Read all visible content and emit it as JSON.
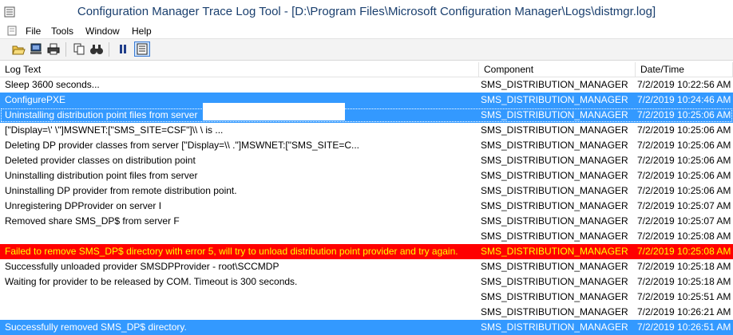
{
  "window": {
    "title": "Configuration Manager Trace Log Tool - [D:\\Program Files\\Microsoft Configuration Manager\\Logs\\distmgr.log]"
  },
  "menu": {
    "items": [
      "File",
      "Tools",
      "Window",
      "Help"
    ]
  },
  "toolbar": {
    "buttons": [
      "open-icon",
      "open-server-icon",
      "print-icon",
      "copy-icon",
      "find-icon",
      "pause-icon",
      "error-lookup-icon"
    ]
  },
  "columns": {
    "log_text": "Log Text",
    "component": "Component",
    "datetime": "Date/Time"
  },
  "rows": [
    {
      "text": "Sleep 3600 seconds...",
      "component": "SMS_DISTRIBUTION_MANAGER",
      "datetime": "7/2/2019 10:22:56 AM",
      "state": "normal"
    },
    {
      "text": "ConfigurePXE",
      "component": "SMS_DISTRIBUTION_MANAGER",
      "datetime": "7/2/2019 10:24:46 AM",
      "state": "selected"
    },
    {
      "text": "Uninstalling distribution point files from server",
      "component": "SMS_DISTRIBUTION_MANAGER",
      "datetime": "7/2/2019 10:25:06 AM",
      "state": "selected"
    },
    {
      "text": "[\"Display=\\'                                                                \\\"]MSWNET:[\"SMS_SITE=CSF\"]\\\\                                           \\ is ...",
      "component": "SMS_DISTRIBUTION_MANAGER",
      "datetime": "7/2/2019 10:25:06 AM",
      "state": "normal"
    },
    {
      "text": "Deleting DP provider classes from server [\"Display=\\\\                                                     .\"]MSWNET:[\"SMS_SITE=C...",
      "component": "SMS_DISTRIBUTION_MANAGER",
      "datetime": "7/2/2019 10:25:06 AM",
      "state": "normal"
    },
    {
      "text": "Deleted provider classes on distribution point",
      "component": "SMS_DISTRIBUTION_MANAGER",
      "datetime": "7/2/2019 10:25:06 AM",
      "state": "normal"
    },
    {
      "text": "Uninstalling distribution point files from server",
      "component": "SMS_DISTRIBUTION_MANAGER",
      "datetime": "7/2/2019 10:25:06 AM",
      "state": "normal"
    },
    {
      "text": "Uninstalling DP provider from remote distribution point.",
      "component": "SMS_DISTRIBUTION_MANAGER",
      "datetime": "7/2/2019 10:25:06 AM",
      "state": "normal"
    },
    {
      "text": "Unregistering DPProvider on server I",
      "component": "SMS_DISTRIBUTION_MANAGER",
      "datetime": "7/2/2019 10:25:07 AM",
      "state": "normal"
    },
    {
      "text": "Removed share SMS_DP$ from server F",
      "component": "SMS_DISTRIBUTION_MANAGER",
      "datetime": "7/2/2019 10:25:07 AM",
      "state": "normal"
    },
    {
      "text": "",
      "component": "SMS_DISTRIBUTION_MANAGER",
      "datetime": "7/2/2019 10:25:08 AM",
      "state": "normal"
    },
    {
      "text": "Failed to remove SMS_DP$ directory with error 5, will try to unload distribution point provider and try again.",
      "component": "SMS_DISTRIBUTION_MANAGER",
      "datetime": "7/2/2019 10:25:08 AM",
      "state": "error"
    },
    {
      "text": "Successfully unloaded provider SMSDPProvider - root\\SCCMDP",
      "component": "SMS_DISTRIBUTION_MANAGER",
      "datetime": "7/2/2019 10:25:18 AM",
      "state": "normal"
    },
    {
      "text": "Waiting for provider to be released by COM. Timeout is 300 seconds.",
      "component": "SMS_DISTRIBUTION_MANAGER",
      "datetime": "7/2/2019 10:25:18 AM",
      "state": "normal"
    },
    {
      "text": "",
      "component": "SMS_DISTRIBUTION_MANAGER",
      "datetime": "7/2/2019 10:25:51 AM",
      "state": "normal"
    },
    {
      "text": "",
      "component": "SMS_DISTRIBUTION_MANAGER",
      "datetime": "7/2/2019 10:26:21 AM",
      "state": "normal"
    },
    {
      "text": "Successfully removed SMS_DP$ directory.",
      "component": "SMS_DISTRIBUTION_MANAGER",
      "datetime": "7/2/2019 10:26:51 AM",
      "state": "selected"
    }
  ],
  "colors": {
    "selected": "#3399ff",
    "error": "#ff0000",
    "error_text": "#ffff00"
  }
}
